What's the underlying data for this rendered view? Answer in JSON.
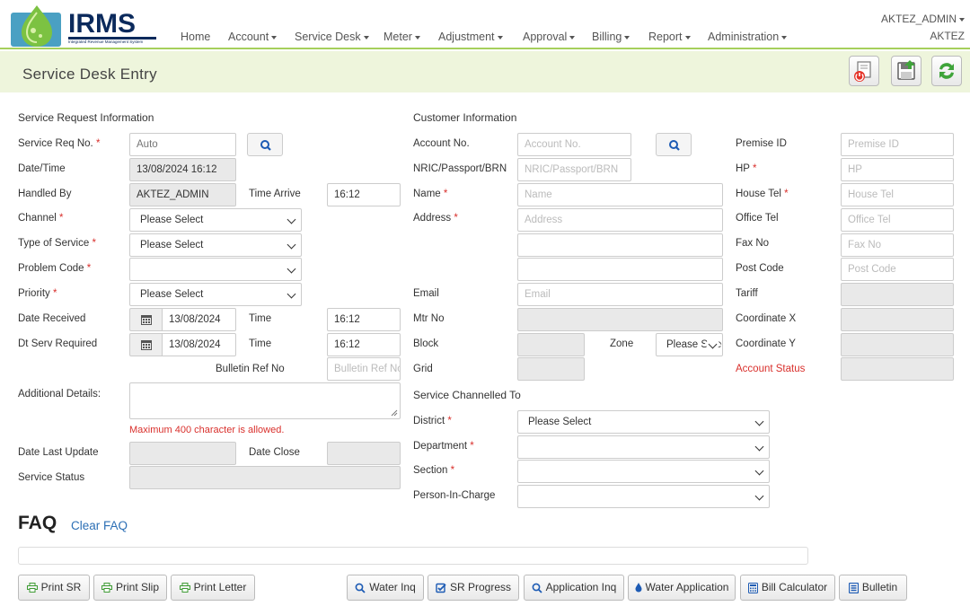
{
  "app": {
    "logo_text": "IRMS",
    "logo_subtitle": "Integrated Revenue Management System"
  },
  "nav": {
    "items": [
      {
        "label": "Home",
        "dropdown": false
      },
      {
        "label": "Account",
        "dropdown": true
      },
      {
        "label": "Service Desk",
        "dropdown": true
      },
      {
        "label": "Meter",
        "dropdown": true
      },
      {
        "label": "Adjustment",
        "dropdown": true
      },
      {
        "label": "Approval",
        "dropdown": true
      },
      {
        "label": "Billing",
        "dropdown": true
      },
      {
        "label": "Report",
        "dropdown": true
      },
      {
        "label": "Administration",
        "dropdown": true
      }
    ],
    "user_name": "AKTEZ_ADMIN",
    "user_short": "AKTEZ"
  },
  "page": {
    "title": "Service Desk Entry",
    "toolbar_icons": [
      "logout-icon",
      "save-icon",
      "refresh-icon"
    ]
  },
  "service_request": {
    "heading": "Service Request Information",
    "service_req_no": {
      "label": "Service Req No.",
      "value": "",
      "placeholder": "Auto"
    },
    "date_time": {
      "label": "Date/Time",
      "value": "13/08/2024 16:12"
    },
    "handled_by": {
      "label": "Handled By",
      "value": "AKTEZ_ADMIN"
    },
    "time_arrive": {
      "label": "Time Arrive",
      "value": "16:12"
    },
    "channel": {
      "label": "Channel",
      "value": "Please Select"
    },
    "type_of_service": {
      "label": "Type of Service",
      "value": "Please Select"
    },
    "problem_code": {
      "label": "Problem Code",
      "value": ""
    },
    "priority": {
      "label": "Priority",
      "value": "Please Select"
    },
    "date_received": {
      "label": "Date Received",
      "value": "13/08/2024"
    },
    "time_received": {
      "label": "Time",
      "value": "16:12"
    },
    "dt_serv_required": {
      "label": "Dt Serv Required",
      "value": "13/08/2024"
    },
    "time_required": {
      "label": "Time",
      "value": "16:12"
    },
    "bulletin_ref_no": {
      "label": "Bulletin Ref No",
      "placeholder": "Bulletin Ref No"
    },
    "additional_details": {
      "label": "Additional Details:",
      "value": ""
    },
    "max_chars_note": "Maximum 400 character is allowed.",
    "date_last_update": {
      "label": "Date Last Update",
      "value": ""
    },
    "date_close": {
      "label": "Date Close",
      "value": ""
    },
    "service_status": {
      "label": "Service Status",
      "value": ""
    }
  },
  "customer": {
    "heading": "Customer Information",
    "account_no": {
      "label": "Account No.",
      "placeholder": "Account No."
    },
    "nric": {
      "label": "NRIC/Passport/BRN",
      "placeholder": "NRIC/Passport/BRN"
    },
    "name": {
      "label": "Name",
      "placeholder": "Name"
    },
    "address": {
      "label": "Address",
      "placeholder": "Address"
    },
    "email": {
      "label": "Email",
      "placeholder": "Email"
    },
    "mtr_no": {
      "label": "Mtr No",
      "value": ""
    },
    "block": {
      "label": "Block",
      "value": ""
    },
    "zone": {
      "label": "Zone",
      "value": "Please Select"
    },
    "grid": {
      "label": "Grid",
      "value": ""
    },
    "premise_id": {
      "label": "Premise ID",
      "placeholder": "Premise ID"
    },
    "hp": {
      "label": "HP",
      "placeholder": "HP"
    },
    "house_tel": {
      "label": "House Tel",
      "placeholder": "House Tel"
    },
    "office_tel": {
      "label": "Office Tel",
      "placeholder": "Office Tel"
    },
    "fax_no": {
      "label": "Fax No",
      "placeholder": "Fax No"
    },
    "post_code": {
      "label": "Post Code",
      "placeholder": "Post Code"
    },
    "tariff": {
      "label": "Tariff",
      "value": ""
    },
    "coord_x": {
      "label": "Coordinate X",
      "value": ""
    },
    "coord_y": {
      "label": "Coordinate Y",
      "value": ""
    },
    "account_status": {
      "label": "Account Status",
      "value": "",
      "color": "#d9302c"
    }
  },
  "channelled": {
    "heading": "Service Channelled To",
    "district": {
      "label": "District",
      "value": "Please Select"
    },
    "department": {
      "label": "Department",
      "value": ""
    },
    "section": {
      "label": "Section",
      "value": ""
    },
    "person_in_charge": {
      "label": "Person-In-Charge",
      "value": ""
    }
  },
  "faq": {
    "title": "FAQ",
    "clear_label": "Clear FAQ"
  },
  "buttons": {
    "print_sr": "Print SR",
    "print_slip": "Print Slip",
    "print_letter": "Print Letter",
    "water_inq": "Water Inq",
    "sr_progress": "SR Progress",
    "application_inq": "Application Inq",
    "water_application": "Water Application",
    "bill_calculator": "Bill Calculator",
    "bulletin": "Bulletin"
  },
  "colors": {
    "accent_green": "#a6cf5c",
    "titlebar_bg": "#eef5dc",
    "required_red": "#d9302c",
    "link_blue": "#2c6fb5",
    "icon_blue": "#1d5bb4",
    "print_green": "#3f9c35"
  }
}
